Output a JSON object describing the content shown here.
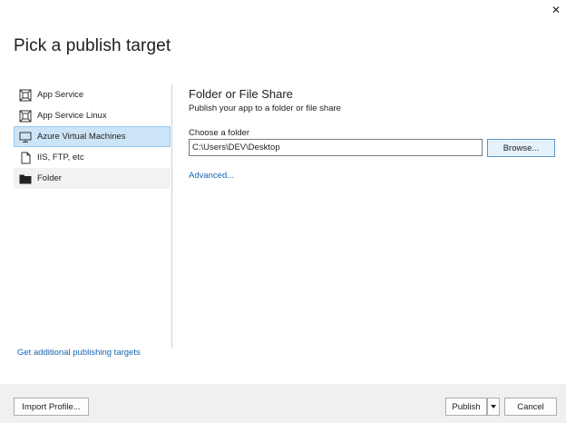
{
  "dialog": {
    "title": "Pick a publish target",
    "close_glyph": "✕"
  },
  "sidebar": {
    "items": [
      {
        "label": "App Service",
        "icon": "app-service-icon"
      },
      {
        "label": "App Service Linux",
        "icon": "app-service-linux-icon"
      },
      {
        "label": "Azure Virtual Machines",
        "icon": "virtual-machine-icon"
      },
      {
        "label": "IIS, FTP, etc",
        "icon": "document-icon"
      },
      {
        "label": "Folder",
        "icon": "folder-icon"
      }
    ],
    "selected": "Azure Virtual Machines",
    "more_link": "Get additional publishing targets"
  },
  "pane": {
    "title": "Folder or File Share",
    "description": "Publish your app to a folder or file share",
    "folder_label": "Choose a folder",
    "folder_value": "C:\\Users\\DEV\\Desktop",
    "browse_label": "Browse...",
    "advanced_link": "Advanced..."
  },
  "footer": {
    "import_label": "Import Profile...",
    "publish_label": "Publish",
    "cancel_label": "Cancel"
  },
  "colors": {
    "link": "#1a65b0",
    "selected_bg": "#cce4f7",
    "footer_bg": "#f0f0f0"
  }
}
